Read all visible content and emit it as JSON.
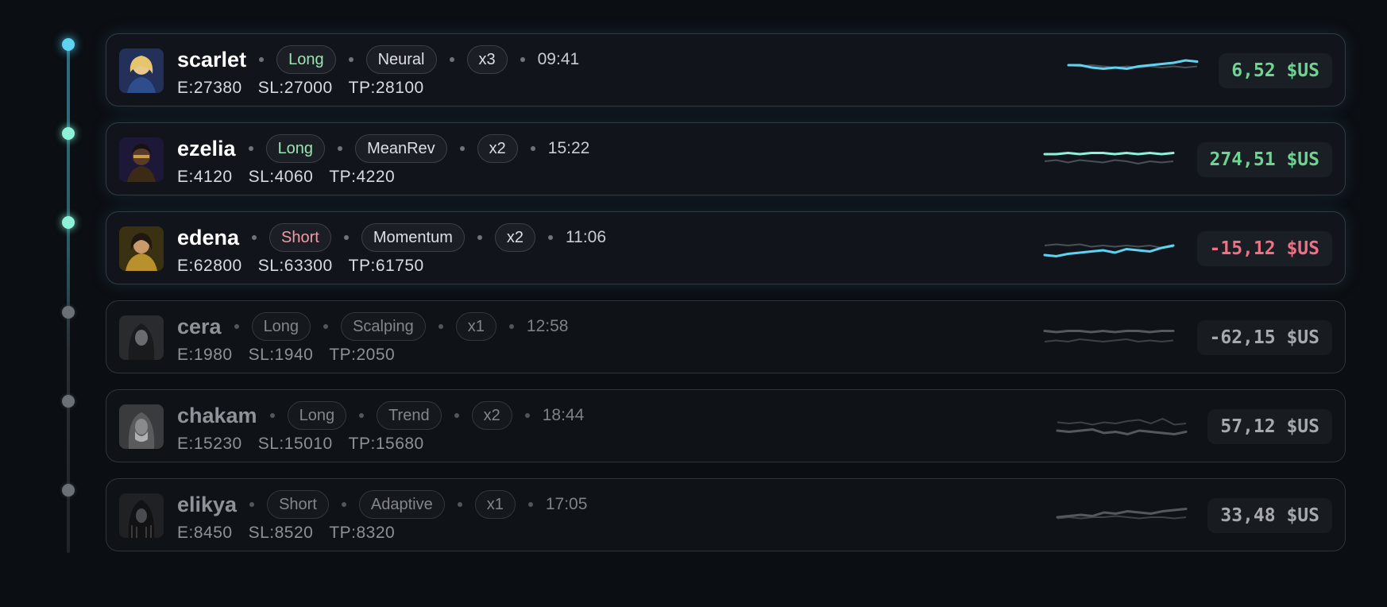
{
  "colors": {
    "accent_blue": "#5fd3f2",
    "accent_teal": "#8ef1d8",
    "positive": "#6fd392",
    "negative": "#ef7186",
    "muted": "#8f9298"
  },
  "trades": [
    {
      "name": "scarlet",
      "side": "Long",
      "strategy": "Neural",
      "leverage": "x3",
      "time": "09:41",
      "entry": "E:27380",
      "stop_loss": "SL:27000",
      "take_profit": "TP:28100",
      "pnl": "6,52 $US",
      "pnl_sign": "pos",
      "active": true,
      "spark_primary": [
        6,
        6,
        8,
        9,
        8,
        9,
        7,
        6,
        5,
        4,
        2,
        3
      ],
      "spark_secondary": [
        6,
        7,
        6,
        7,
        8,
        7,
        8,
        7,
        8,
        7,
        8,
        7
      ]
    },
    {
      "name": "ezelia",
      "side": "Long",
      "strategy": "MeanRev",
      "leverage": "x2",
      "time": "15:22",
      "entry": "E:4120",
      "stop_loss": "SL:4060",
      "take_profit": "TP:4220",
      "pnl": "274,51 $US",
      "pnl_sign": "pos",
      "active": true,
      "spark_primary": [
        6,
        6,
        5,
        6,
        5,
        5,
        6,
        5,
        6,
        5,
        6,
        5
      ],
      "spark_secondary": [
        12,
        11,
        13,
        11,
        12,
        13,
        11,
        12,
        14,
        12,
        13,
        12
      ]
    },
    {
      "name": "edena",
      "side": "Short",
      "strategy": "Momentum",
      "leverage": "x2",
      "time": "11:06",
      "entry": "E:62800",
      "stop_loss": "SL:63300",
      "take_profit": "TP:61750",
      "pnl": "-15,12 $US",
      "pnl_sign": "neg",
      "active": true,
      "spark_primary": [
        16,
        17,
        15,
        14,
        13,
        12,
        14,
        11,
        12,
        13,
        10,
        8
      ],
      "spark_secondary": [
        8,
        7,
        8,
        7,
        9,
        8,
        9,
        8,
        9,
        8,
        10,
        9
      ]
    },
    {
      "name": "cera",
      "side": "Long",
      "strategy": "Scalping",
      "leverage": "x1",
      "time": "12:58",
      "entry": "E:1980",
      "stop_loss": "SL:1940",
      "take_profit": "TP:2050",
      "pnl": "-62,15 $US",
      "pnl_sign": "neg",
      "active": false,
      "spark_primary": [
        5,
        6,
        5,
        5,
        6,
        5,
        6,
        5,
        5,
        6,
        5,
        5
      ],
      "spark_secondary": [
        14,
        13,
        14,
        12,
        13,
        14,
        13,
        12,
        14,
        13,
        14,
        13
      ]
    },
    {
      "name": "chakam",
      "side": "Long",
      "strategy": "Trend",
      "leverage": "x2",
      "time": "18:44",
      "entry": "E:15230",
      "stop_loss": "SL:15010",
      "take_profit": "TP:15680",
      "pnl": "57,12 $US",
      "pnl_sign": "pos",
      "active": false,
      "spark_primary": [
        14,
        15,
        14,
        13,
        16,
        15,
        17,
        14,
        15,
        16,
        17,
        15
      ],
      "spark_secondary": [
        7,
        8,
        7,
        9,
        7,
        8,
        6,
        5,
        8,
        4,
        9,
        8
      ]
    },
    {
      "name": "elikya",
      "side": "Short",
      "strategy": "Adaptive",
      "leverage": "x1",
      "time": "17:05",
      "entry": "E:8450",
      "stop_loss": "SL:8520",
      "take_profit": "TP:8320",
      "pnl": "33,48 $US",
      "pnl_sign": "pos",
      "active": false,
      "spark_primary": [
        12,
        11,
        10,
        11,
        8,
        9,
        7,
        8,
        9,
        7,
        6,
        5
      ],
      "spark_secondary": [
        13,
        12,
        13,
        12,
        12,
        11,
        12,
        13,
        12,
        12,
        13,
        12
      ]
    }
  ]
}
